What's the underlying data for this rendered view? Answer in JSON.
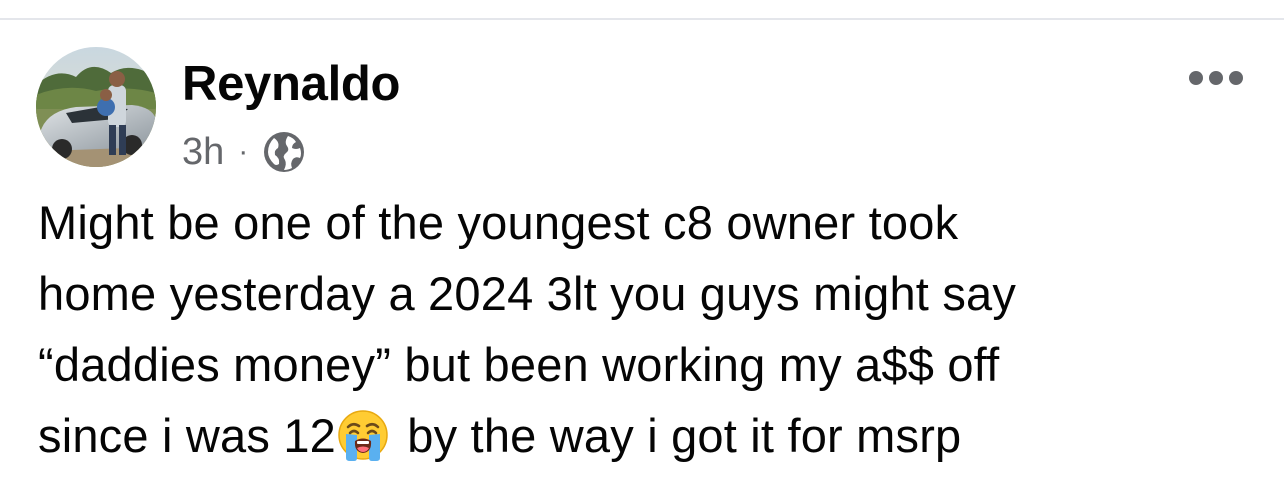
{
  "post": {
    "author": {
      "name": "Reynaldo",
      "avatar_icon": "profile-photo"
    },
    "meta": {
      "time": "3h",
      "separator": "·",
      "privacy_icon": "globe-icon"
    },
    "more_icon": "more-options-icon",
    "text_lines": [
      "Might be one of the youngest c8 owner took",
      "home yesterday a 2024 3lt you guys might say",
      "“daddies money” but been working my a$$ off"
    ],
    "last_line": {
      "before_emoji": "since i was 12",
      "emoji": "loudly-crying-face",
      "after_emoji": " by the way i got it for msrp"
    }
  },
  "colors": {
    "text_primary": "#050505",
    "text_secondary": "#65676b",
    "divider": "#e4e6eb"
  }
}
